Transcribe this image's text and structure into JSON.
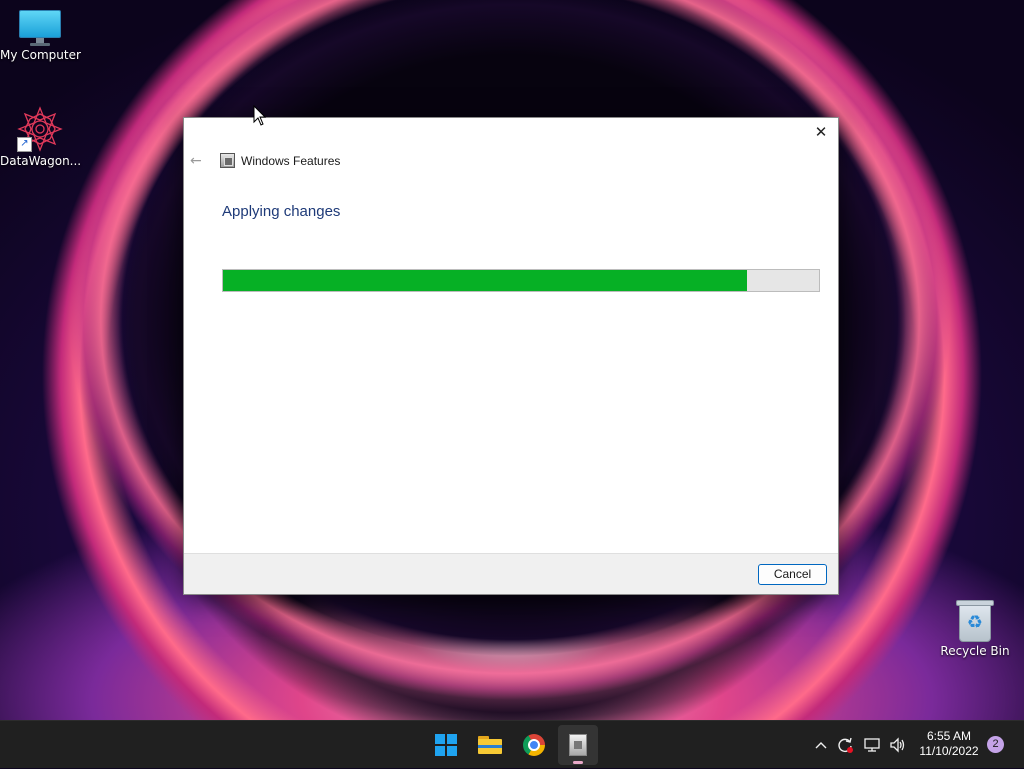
{
  "desktop": {
    "icons": [
      {
        "label": "My Computer",
        "icon": "monitor-icon"
      },
      {
        "label": "DataWagon...",
        "icon": "datawagon-icon"
      },
      {
        "label": "Recycle Bin",
        "icon": "recycle-bin-icon"
      }
    ]
  },
  "dialog": {
    "title": "Windows Features",
    "close_glyph": "✕",
    "back_glyph": "←",
    "heading": "Applying changes",
    "progress_percent": 88,
    "progress_color": "#06b025",
    "cancel_label": "Cancel"
  },
  "taskbar": {
    "apps": [
      {
        "name": "Start",
        "icon": "windows-logo-icon"
      },
      {
        "name": "File Explorer",
        "icon": "folder-icon"
      },
      {
        "name": "Google Chrome",
        "icon": "chrome-icon"
      },
      {
        "name": "Windows Features",
        "icon": "windows-features-icon",
        "active": true
      }
    ],
    "tray": {
      "chevron": "^",
      "time": "6:55 AM",
      "date": "11/10/2022",
      "notification_count": "2"
    }
  }
}
